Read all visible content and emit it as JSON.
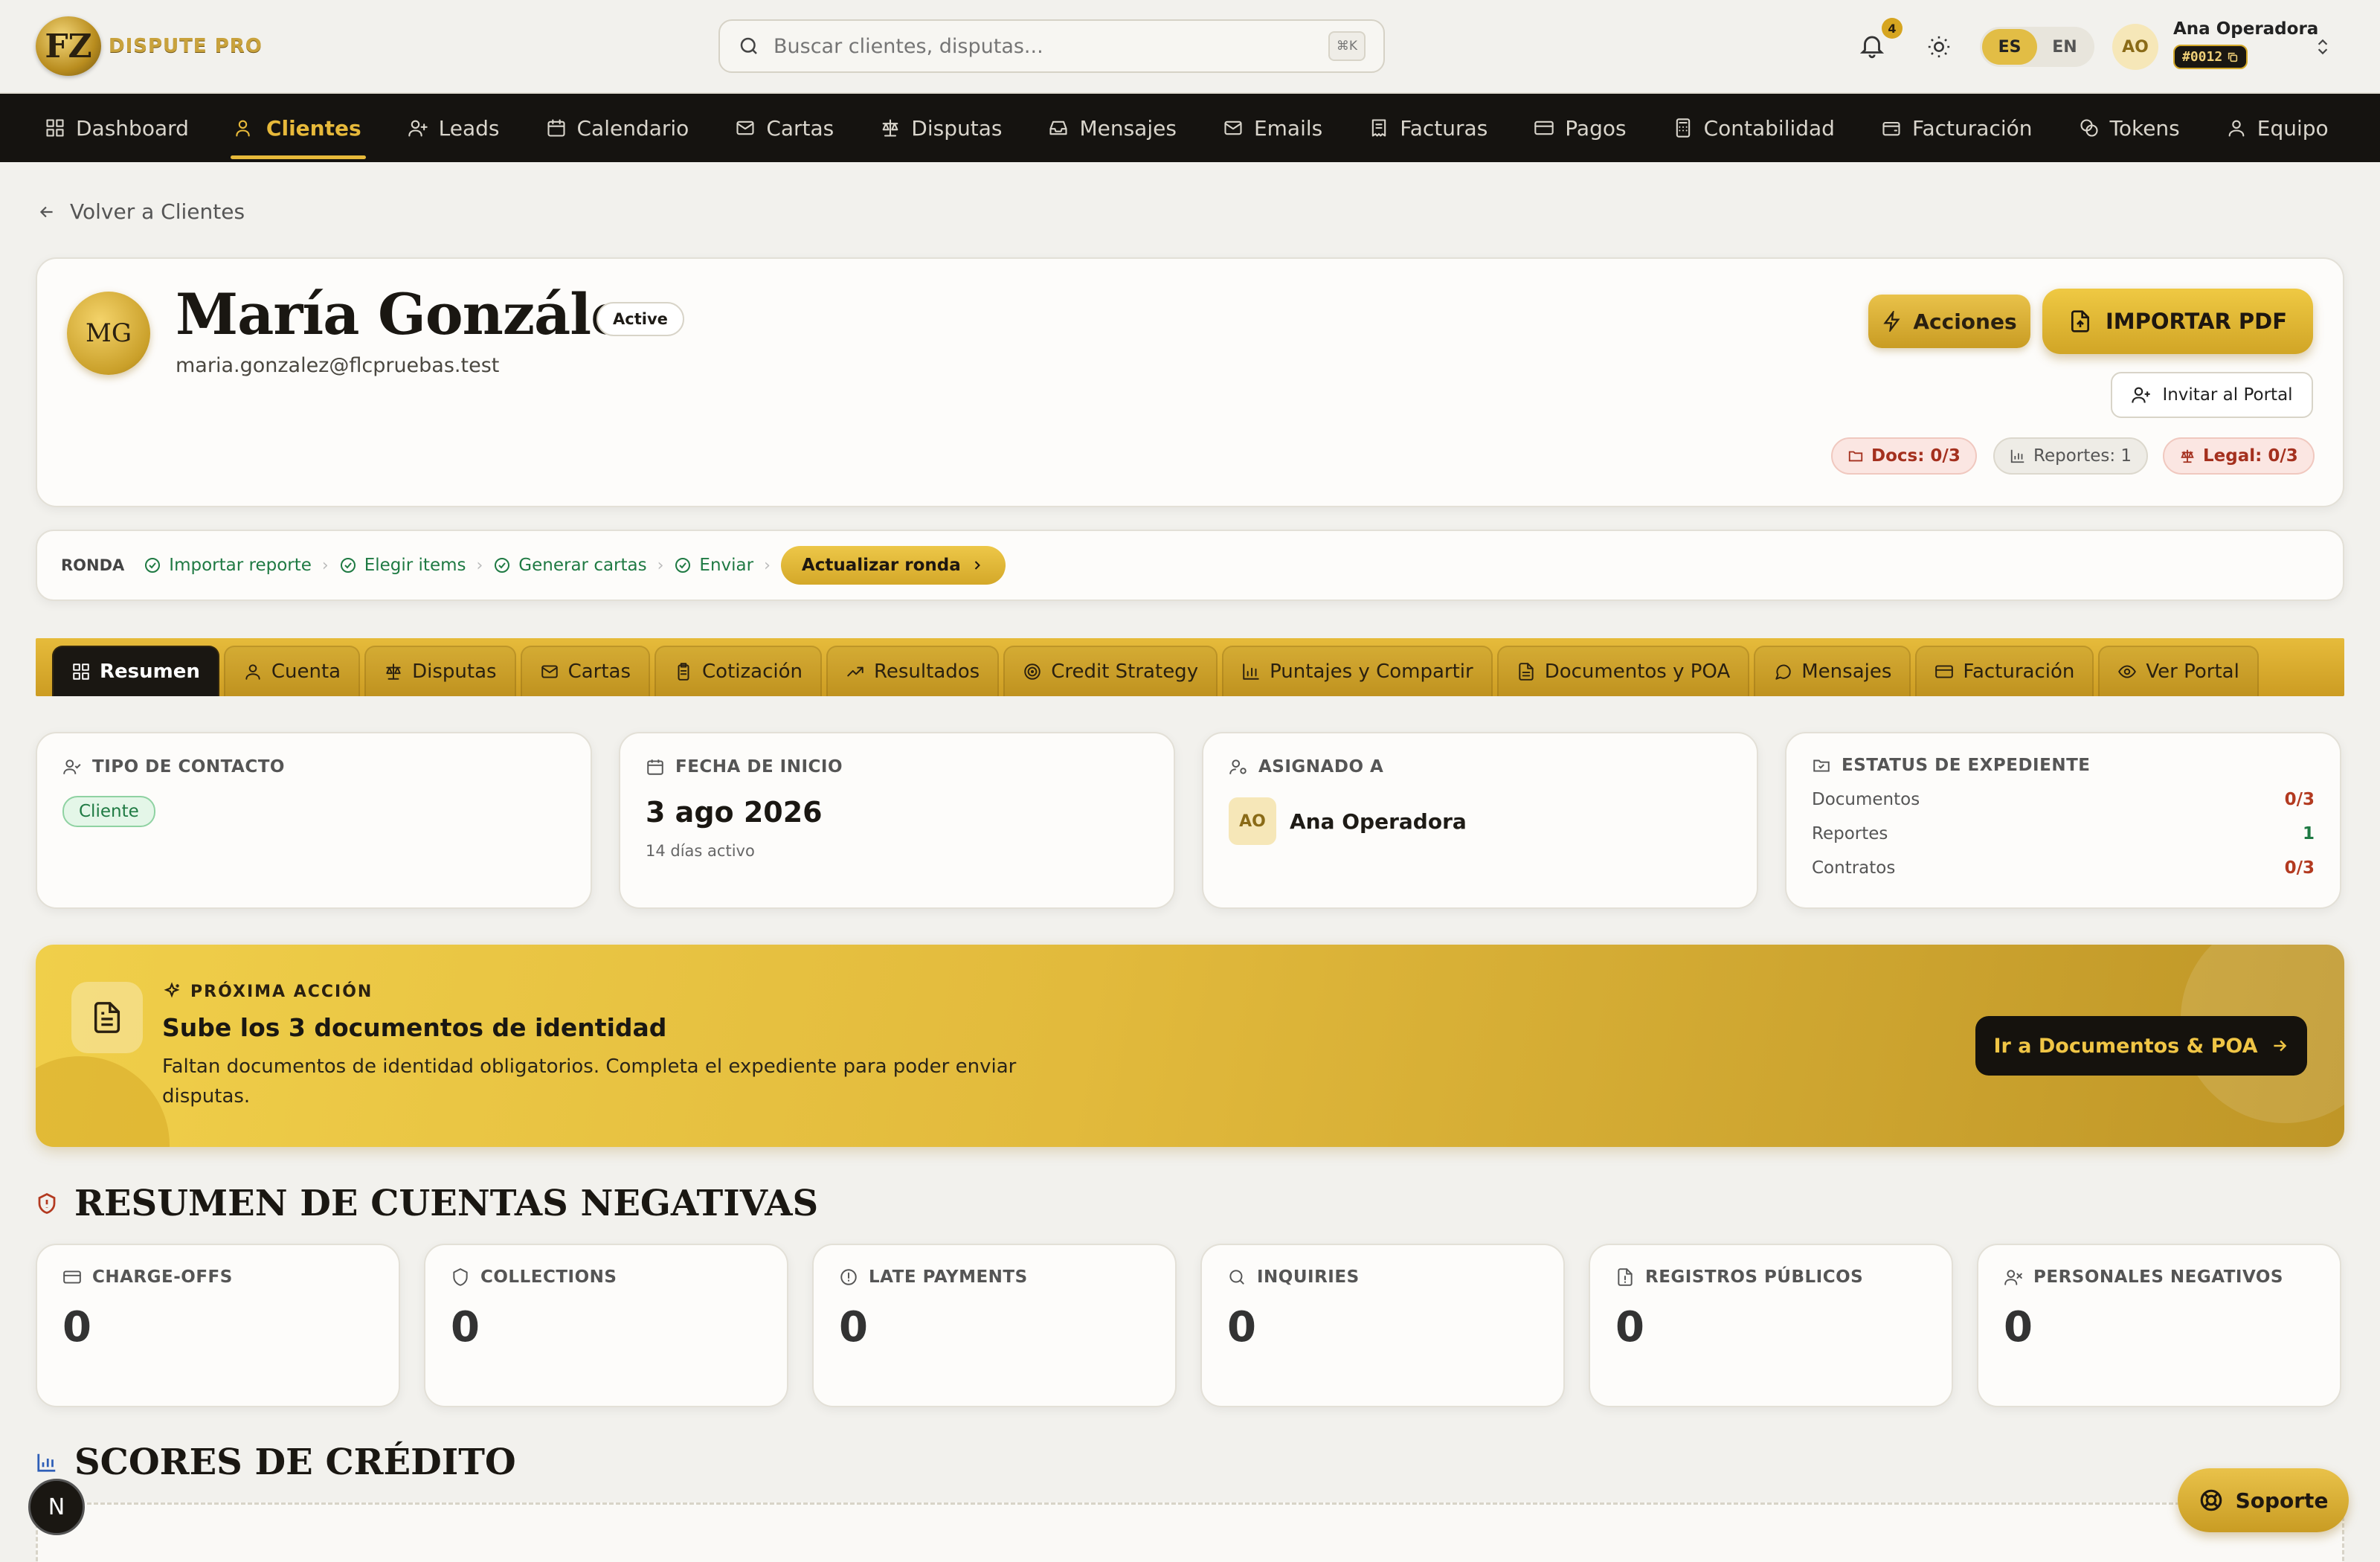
{
  "brand": {
    "name": "DISPUTE PRO",
    "mark": "FZ"
  },
  "search": {
    "placeholder": "Buscar clientes, disputas...",
    "shortcut": "⌘K"
  },
  "header": {
    "notifications": "4",
    "lang": {
      "es": "ES",
      "en": "EN",
      "selected": "ES"
    },
    "user": {
      "initials": "AO",
      "name": "Ana Operadora",
      "id": "#0012"
    }
  },
  "nav": [
    {
      "label": "Dashboard",
      "icon": "dashboard-icon"
    },
    {
      "label": "Clientes",
      "icon": "users-icon",
      "active": true
    },
    {
      "label": "Leads",
      "icon": "user-plus-icon"
    },
    {
      "label": "Calendario",
      "icon": "calendar-icon"
    },
    {
      "label": "Cartas",
      "icon": "mail-icon"
    },
    {
      "label": "Disputas",
      "icon": "scale-icon"
    },
    {
      "label": "Mensajes",
      "icon": "inbox-icon"
    },
    {
      "label": "Emails",
      "icon": "mail-icon"
    },
    {
      "label": "Facturas",
      "icon": "receipt-icon"
    },
    {
      "label": "Pagos",
      "icon": "credit-card-icon"
    },
    {
      "label": "Contabilidad",
      "icon": "calculator-icon"
    },
    {
      "label": "Facturación",
      "icon": "wallet-icon"
    },
    {
      "label": "Tokens",
      "icon": "coins-icon"
    },
    {
      "label": "Equipo",
      "icon": "team-icon"
    }
  ],
  "back": "Volver a Clientes",
  "client": {
    "initials": "MG",
    "name": "María González",
    "status": "Active",
    "email": "maria.gonzalez@flcpruebas.test",
    "actions_label": "Acciones",
    "import_label": "IMPORTAR PDF",
    "invite_label": "Invitar al Portal",
    "pills": {
      "docs": "Docs: 0/3",
      "reports": "Reportes: 1",
      "legal": "Legal: 0/3"
    }
  },
  "round": {
    "label": "RONDA",
    "steps": [
      "Importar reporte",
      "Elegir items",
      "Generar cartas",
      "Enviar"
    ],
    "button": "Actualizar ronda"
  },
  "tabs": [
    {
      "label": "Resumen",
      "icon": "grid-icon",
      "active": true
    },
    {
      "label": "Cuenta",
      "icon": "user-icon"
    },
    {
      "label": "Disputas",
      "icon": "scale-icon"
    },
    {
      "label": "Cartas",
      "icon": "mail-icon"
    },
    {
      "label": "Cotización",
      "icon": "clipboard-icon"
    },
    {
      "label": "Resultados",
      "icon": "trend-icon"
    },
    {
      "label": "Credit Strategy",
      "icon": "target-icon"
    },
    {
      "label": "Puntajes y Compartir",
      "icon": "bar-chart-icon"
    },
    {
      "label": "Documentos y POA",
      "icon": "document-icon"
    },
    {
      "label": "Mensajes",
      "icon": "chat-icon"
    },
    {
      "label": "Facturación",
      "icon": "credit-card-icon"
    },
    {
      "label": "Ver Portal",
      "icon": "eye-icon"
    }
  ],
  "info": {
    "contact": {
      "title": "TIPO DE CONTACTO",
      "value": "Cliente"
    },
    "start": {
      "title": "FECHA DE INICIO",
      "value": "3 ago 2026",
      "sub": "14 días activo"
    },
    "assigned": {
      "title": "ASIGNADO A",
      "initials": "AO",
      "name": "Ana Operadora"
    },
    "status": {
      "title": "ESTATUS DE EXPEDIENTE",
      "rows": [
        {
          "label": "Documentos",
          "value": "0/3"
        },
        {
          "label": "Reportes",
          "value": "1"
        },
        {
          "label": "Contratos",
          "value": "0/3"
        }
      ]
    }
  },
  "next": {
    "kicker": "PRÓXIMA ACCIÓN",
    "title": "Sube los 3 documentos de identidad",
    "desc": "Faltan documentos de identidad obligatorios. Completa el expediente para poder enviar disputas.",
    "button": "Ir a Documentos & POA"
  },
  "negative": {
    "title": "RESUMEN DE CUENTAS NEGATIVAS",
    "cards": [
      {
        "label": "CHARGE-OFFS",
        "value": "0",
        "icon": "credit-card-icon"
      },
      {
        "label": "COLLECTIONS",
        "value": "0",
        "icon": "shield-icon"
      },
      {
        "label": "LATE PAYMENTS",
        "value": "0",
        "icon": "alert-circle-icon"
      },
      {
        "label": "INQUIRIES",
        "value": "0",
        "icon": "search-icon"
      },
      {
        "label": "REGISTROS PÚBLICOS",
        "value": "0",
        "icon": "file-alert-icon"
      },
      {
        "label": "PERSONALES NEGATIVOS",
        "value": "0",
        "icon": "user-x-icon"
      }
    ]
  },
  "scores": {
    "title": "SCORES DE CRÉDITO"
  },
  "fab": {
    "n": "N",
    "support": "Soporte"
  },
  "colors": {
    "gold": "#e2bd45",
    "dark": "#151310",
    "green": "#1f7a43",
    "red": "#b33a20"
  }
}
